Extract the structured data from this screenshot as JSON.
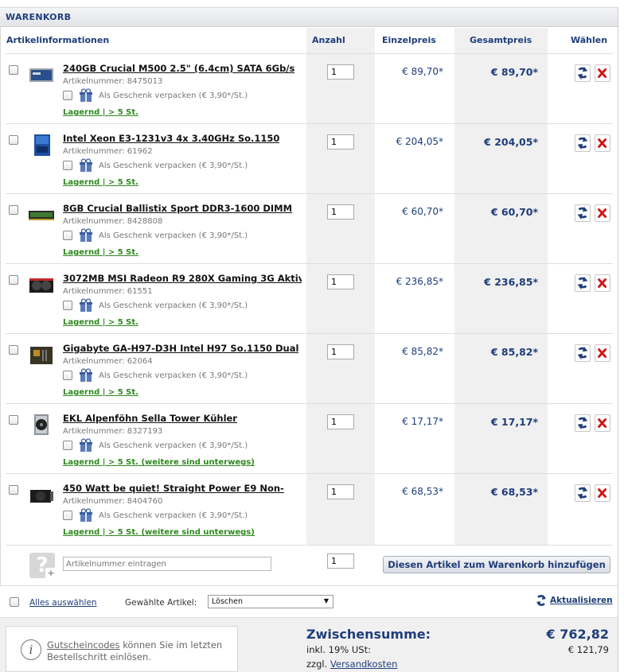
{
  "title": "WARENKORB",
  "headers": {
    "info": "Artikelinformationen",
    "qty": "Anzahl",
    "unit": "Einzelpreis",
    "total": "Gesamtpreis",
    "select": "Wählen"
  },
  "items": [
    {
      "name": "240GB Crucial M500 2.5\" (6.4cm) SATA 6Gb/s",
      "artnr": "Artikelnummer: 8475013",
      "gift": "Als Geschenk verpacken (€ 3,90*/St.)",
      "stock": "Lagernd | > 5 St.",
      "qty": "1",
      "unit": "€ 89,70*",
      "total": "€ 89,70*",
      "icon": "ssd-icon"
    },
    {
      "name": "Intel Xeon E3-1231v3 4x 3.40GHz So.1150",
      "artnr": "Artikelnummer: 61962",
      "gift": "Als Geschenk verpacken (€ 3,90*/St.)",
      "stock": "Lagernd | > 5 St.",
      "qty": "1",
      "unit": "€ 204,05*",
      "total": "€ 204,05*",
      "icon": "cpu-box-icon"
    },
    {
      "name": "8GB Crucial Ballistix Sport DDR3-1600 DIMM",
      "artnr": "Artikelnummer: 8428808",
      "gift": "Als Geschenk verpacken (€ 3,90*/St.)",
      "stock": "Lagernd | > 5 St.",
      "qty": "1",
      "unit": "€ 60,70*",
      "total": "€ 60,70*",
      "icon": "ram-icon"
    },
    {
      "name": "3072MB MSI Radeon R9 280X Gaming 3G Aktiv",
      "artnr": "Artikelnummer: 61551",
      "gift": "Als Geschenk verpacken (€ 3,90*/St.)",
      "stock": "Lagernd | > 5 St.",
      "qty": "1",
      "unit": "€ 236,85*",
      "total": "€ 236,85*",
      "icon": "gpu-icon"
    },
    {
      "name": "Gigabyte GA-H97-D3H Intel H97 So.1150 Dual",
      "artnr": "Artikelnummer: 62064",
      "gift": "Als Geschenk verpacken (€ 3,90*/St.)",
      "stock": "Lagernd | > 5 St.",
      "qty": "1",
      "unit": "€ 85,82*",
      "total": "€ 85,82*",
      "icon": "mainboard-icon"
    },
    {
      "name": "EKL Alpenföhn Sella Tower Kühler",
      "artnr": "Artikelnummer: 8327193",
      "gift": "Als Geschenk verpacken (€ 3,90*/St.)",
      "stock": "Lagernd | > 5 St. (weitere sind unterwegs)",
      "qty": "1",
      "unit": "€ 17,17*",
      "total": "€ 17,17*",
      "icon": "cooler-icon"
    },
    {
      "name": "450 Watt be quiet! Straight Power E9 Non-",
      "artnr": "Artikelnummer: 8404760",
      "gift": "Als Geschenk verpacken (€ 3,90*/St.)",
      "stock": "Lagernd | > 5 St. (weitere sind unterwegs)",
      "qty": "1",
      "unit": "€ 68,53*",
      "total": "€ 68,53*",
      "icon": "psu-icon"
    }
  ],
  "add": {
    "placeholder": "Artikelnummer eintragen",
    "qty": "1",
    "button": "Diesen Artikel zum Warenkorb hinzufügen"
  },
  "actions": {
    "select_all": "Alles auswählen",
    "selected_label": "Gewählte Artikel:",
    "selected_value": "Löschen",
    "refresh": "Aktualisieren"
  },
  "footer": {
    "voucher_link": "Gutscheincodes",
    "voucher_rest": " können Sie im letzten Bestellschritt einlösen.",
    "subtotal_label": "Zwischensumme:",
    "subtotal": "€ 762,82",
    "vat_label": "inkl. 19% USt:",
    "vat": "€ 121,79",
    "shipping_prefix": "zzgl. ",
    "shipping_link": "Versandkosten"
  },
  "colors": {
    "accent": "#1f3e7a",
    "stock": "#2d8a1d",
    "delete": "#d01818"
  }
}
